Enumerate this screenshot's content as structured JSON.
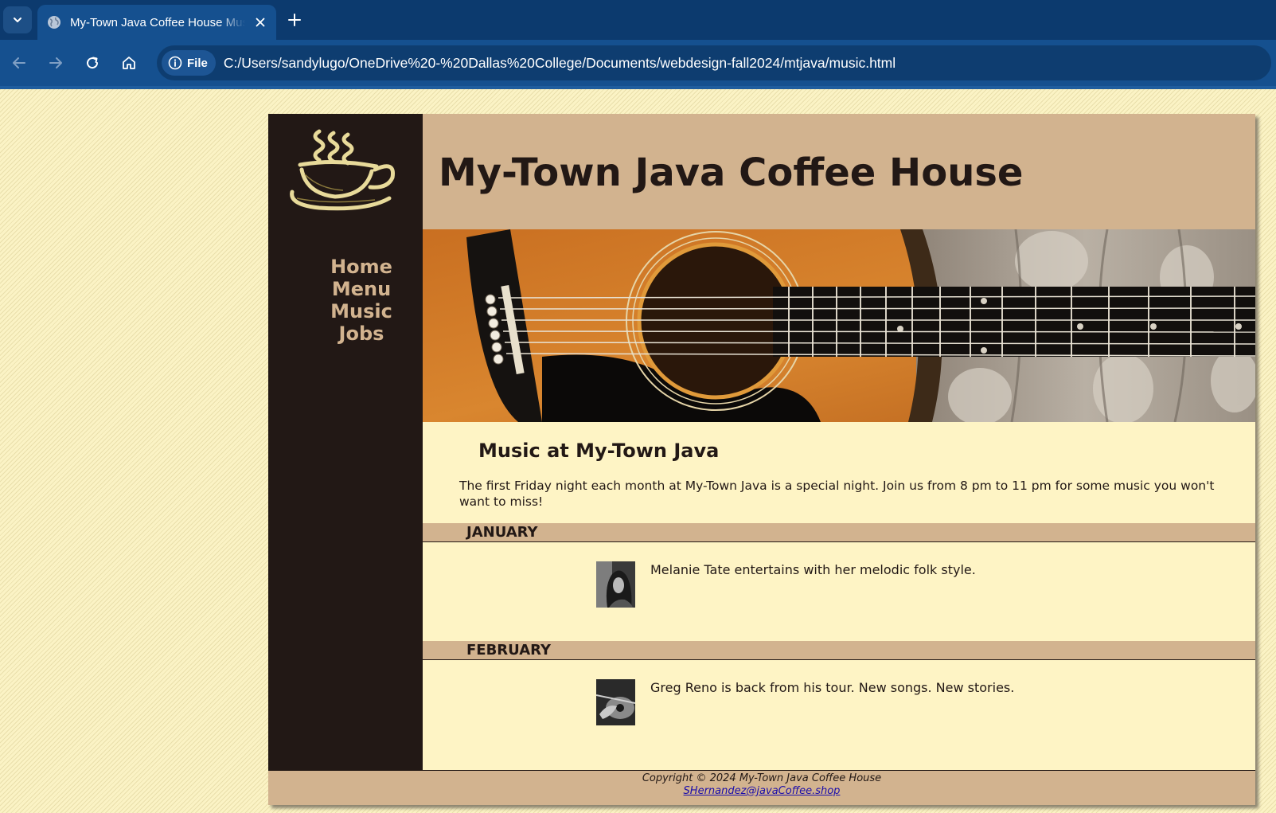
{
  "browser": {
    "tab": {
      "title": "My-Town Java Coffee House Music"
    },
    "site_chip": {
      "label": "File"
    },
    "address": {
      "url": "C:/Users/sandylugo/OneDrive%20-%20Dallas%20College/Documents/webdesign-fall2024/mtjava/music.html"
    },
    "icons": [
      "tab-list-chevron-icon",
      "globe-icon",
      "close-icon",
      "plus-icon",
      "back-arrow-icon",
      "forward-arrow-icon",
      "reload-icon",
      "home-icon",
      "info-icon"
    ]
  },
  "page": {
    "site_title": "My-Town Java Coffee House",
    "nav": [
      {
        "label": "Home"
      },
      {
        "label": "Menu"
      },
      {
        "label": "Music"
      },
      {
        "label": "Jobs"
      }
    ],
    "content": {
      "heading": "Music at My-Town Java",
      "intro": "The first Friday night each month at My-Town Java is a special night. Join us from 8 pm to 11 pm for some music you won't want to miss!",
      "months": [
        {
          "month": "JANUARY",
          "description": "Melanie Tate entertains with her melodic folk style."
        },
        {
          "month": "FEBRUARY",
          "description": "Greg Reno is back from his tour. New songs. New stories."
        }
      ]
    },
    "footer": {
      "copyright": "Copyright © 2024 My-Town Java Coffee House",
      "email": "SHernandez@javaCoffee.shop"
    },
    "colors": {
      "sidebar": "#221815",
      "tan": "#d2b38f",
      "cream": "#fef4c5",
      "text": "#221815",
      "browser_frame": "#0c3a6e",
      "browser_toolbar": "#15508f"
    }
  }
}
